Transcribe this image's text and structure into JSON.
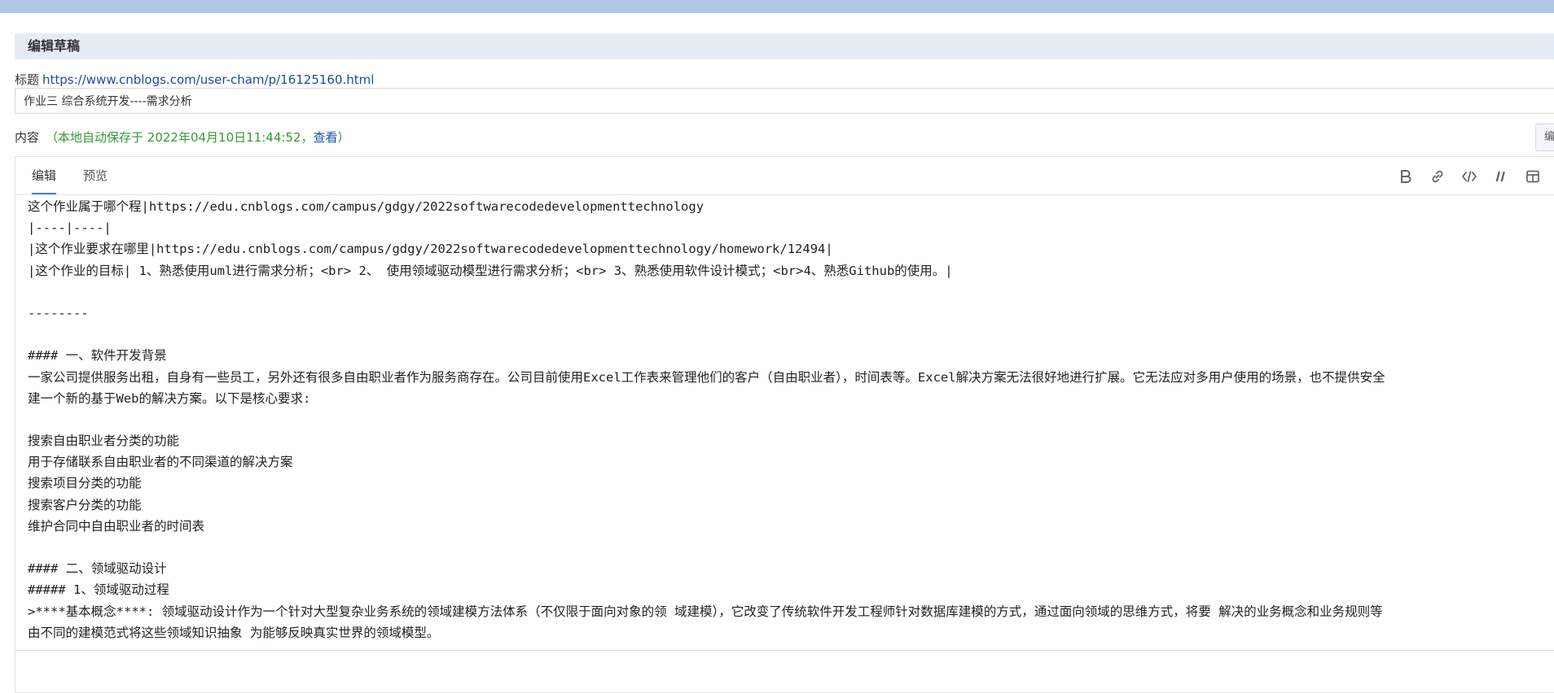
{
  "header": {
    "title": "编辑草稿"
  },
  "title_field": {
    "label": "标题",
    "link": "https://www.cnblogs.com/user-cham/p/16125160.html",
    "value": "作业三 综合系统开发----需求分析"
  },
  "content_field": {
    "label": "内容",
    "autosave_prefix": "（本地自动保存于 2022年04月10日11:44:52，",
    "autosave_link": "查看",
    "autosave_suffix": "）",
    "edit_mode_label": "编"
  },
  "editor": {
    "tabs": [
      "编辑",
      "预览"
    ],
    "active_tab": "编辑",
    "toolbar": [
      "bold-icon",
      "link-icon",
      "code-icon",
      "quote-icon",
      "table-icon"
    ],
    "lines": [
      "这个作业属于哪个程|https://edu.cnblogs.com/campus/gdgy/2022softwarecodedevelopmenttechnology",
      "|----|----|",
      "|这个作业要求在哪里|https://edu.cnblogs.com/campus/gdgy/2022softwarecodedevelopmenttechnology/homework/12494|",
      "|这个作业的目标| 1、熟悉使用uml进行需求分析；<br> 2、 使用领域驱动模型进行需求分析；<br> 3、熟悉使用软件设计模式；<br>4、熟悉Github的使用。|",
      "",
      "--------",
      "",
      "#### 一、软件开发背景",
      "一家公司提供服务出租，自身有一些员工，另外还有很多自由职业者作为服务商存在。公司目前使用Excel工作表来管理他们的客户（自由职业者），时间表等。Excel解决方案无法很好地进行扩展。它无法应对多用户使用的场景，也不提供安全",
      "建一个新的基于Web的解决方案。以下是核心要求:",
      "",
      "搜索自由职业者分类的功能",
      "用于存储联系自由职业者的不同渠道的解决方案",
      "搜索项目分类的功能",
      "搜索客户分类的功能",
      "维护合同中自由职业者的时间表",
      "",
      "#### 二、领域驱动设计",
      "##### 1、领域驱动过程",
      ">****基本概念****: 领域驱动设计作为一个针对大型复杂业务系统的领域建模方法体系（不仅限于面向对象的领 域建模），它改变了传统软件开发工程师针对数据库建模的方式，通过面向领域的思维方式，将要 解决的业务概念和业务规则等",
      "由不同的建模范式将这些领域知识抽象 为能够反映真实世界的领域模型。"
    ]
  }
}
